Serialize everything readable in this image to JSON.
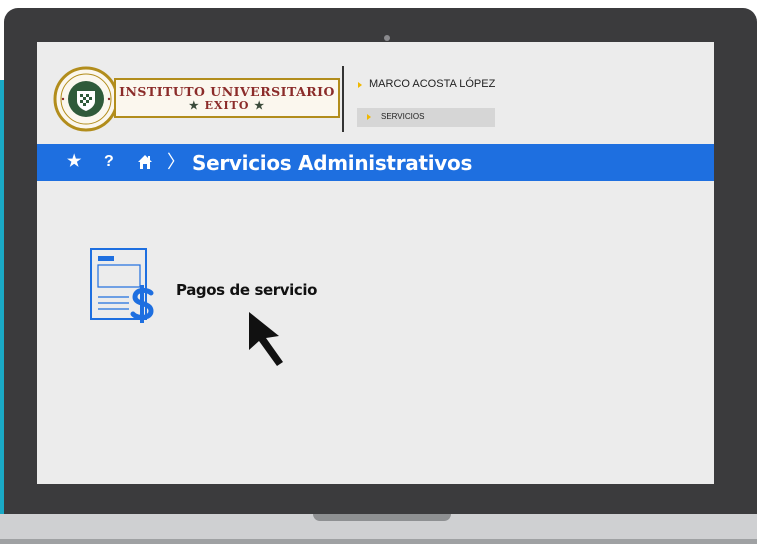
{
  "header": {
    "logo_line1": "INSTITUTO UNIVERSITARIO",
    "logo_line2": "EXITO",
    "user_name": "MARCO ACOSTA LÓPEZ",
    "section_chip": "SERVICIOS"
  },
  "nav": {
    "icons": [
      "star-icon",
      "help-icon",
      "home-icon"
    ],
    "help_glyph": "?",
    "separator": "〉",
    "page_title": "Servicios Administrativos"
  },
  "main": {
    "services": [
      {
        "label": "Pagos de servicio",
        "icon": "payment-document-icon"
      }
    ]
  },
  "colors": {
    "accent_blue": "#1e6fe0",
    "teal": "#1aa9c6",
    "gold": "#b28d1c",
    "bezel": "#3b3b3d",
    "screen_bg": "#ececec"
  }
}
